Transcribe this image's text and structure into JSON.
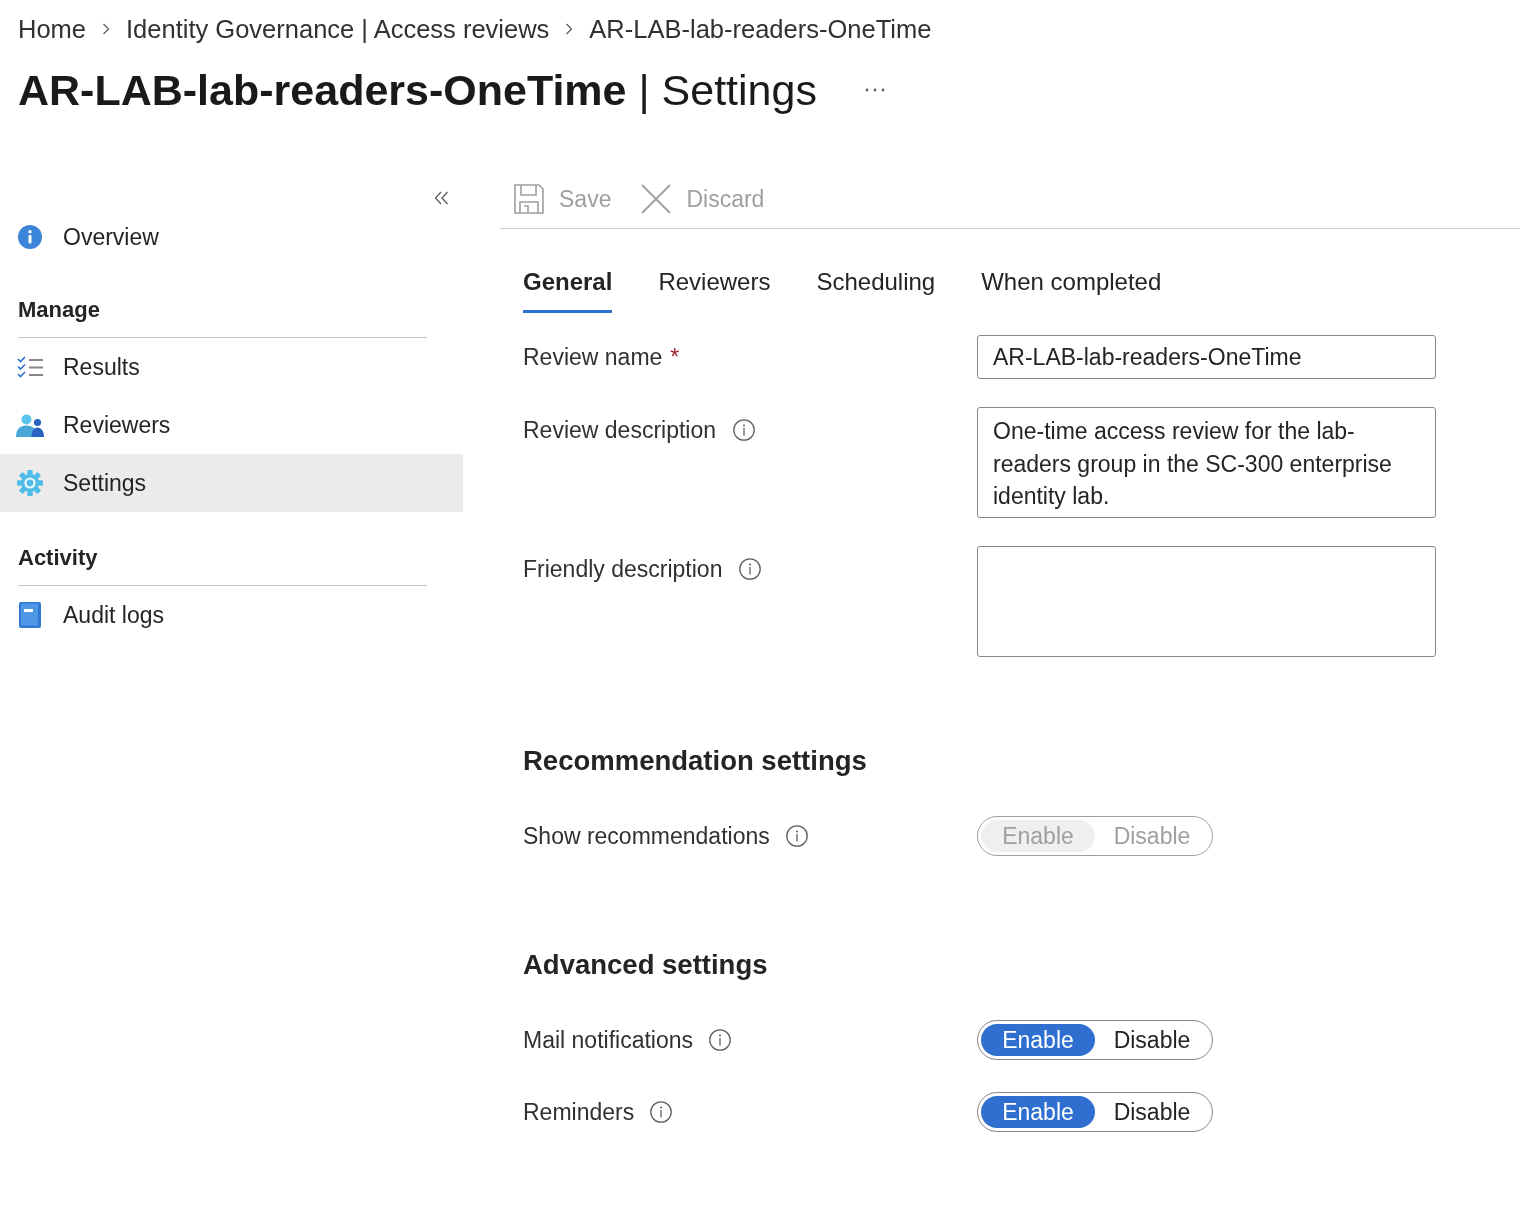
{
  "breadcrumb": [
    {
      "label": "Home"
    },
    {
      "label": "Identity Governance | Access reviews"
    },
    {
      "label": "AR-LAB-lab-readers-OneTime"
    }
  ],
  "header": {
    "title": "**AR-LAB-lab-readers-OneTime** | Settings"
  },
  "sidebar": {
    "top_items": [
      {
        "label": "Overview",
        "selected": false
      }
    ],
    "sections": [
      {
        "heading": "Manage",
        "items": [
          {
            "label": "Results",
            "selected": false
          },
          {
            "label": "Reviewers",
            "selected": false
          },
          {
            "label": "Settings",
            "selected": true
          }
        ]
      },
      {
        "heading": "Activity",
        "items": [
          {
            "label": "Audit logs",
            "selected": false
          }
        ]
      }
    ]
  },
  "toolbar": {
    "buttons": [
      {
        "label": "Save",
        "disabled": true
      },
      {
        "label": "Discard",
        "disabled": true
      }
    ]
  },
  "tabs": [
    {
      "label": "General",
      "selected": true
    },
    {
      "label": "Reviewers",
      "selected": false
    },
    {
      "label": "Scheduling",
      "selected": false
    },
    {
      "label": "When completed",
      "selected": false
    }
  ],
  "form": {
    "fields": [
      {
        "kind": "input",
        "label": "Review name",
        "required_mark": "*",
        "info": false,
        "value": "AR-LAB-lab-readers-OneTime"
      },
      {
        "kind": "textarea",
        "label": "Review description",
        "info": true,
        "value": "One-time access review for the lab-readers group in the SC-300 enterprise identity lab."
      },
      {
        "kind": "textarea",
        "label": "Friendly description",
        "info": true
      }
    ]
  },
  "settings_sections": [
    {
      "heading": "Recommendation settings",
      "rows": [
        {
          "label": "Show recommendations",
          "info": true,
          "disabled": true,
          "options": [
            {
              "label": "Enable",
              "selected": true
            },
            {
              "label": "Disable",
              "selected": false
            }
          ]
        }
      ]
    },
    {
      "heading": "Advanced settings",
      "rows": [
        {
          "label": "Mail notifications",
          "info": true,
          "disabled": false,
          "options": [
            {
              "label": "Enable",
              "selected": true
            },
            {
              "label": "Disable",
              "selected": false
            }
          ]
        },
        {
          "label": "Reminders",
          "info": true,
          "disabled": false,
          "options": [
            {
              "label": "Enable",
              "selected": true
            },
            {
              "label": "Disable",
              "selected": false
            }
          ]
        }
      ]
    }
  ]
}
